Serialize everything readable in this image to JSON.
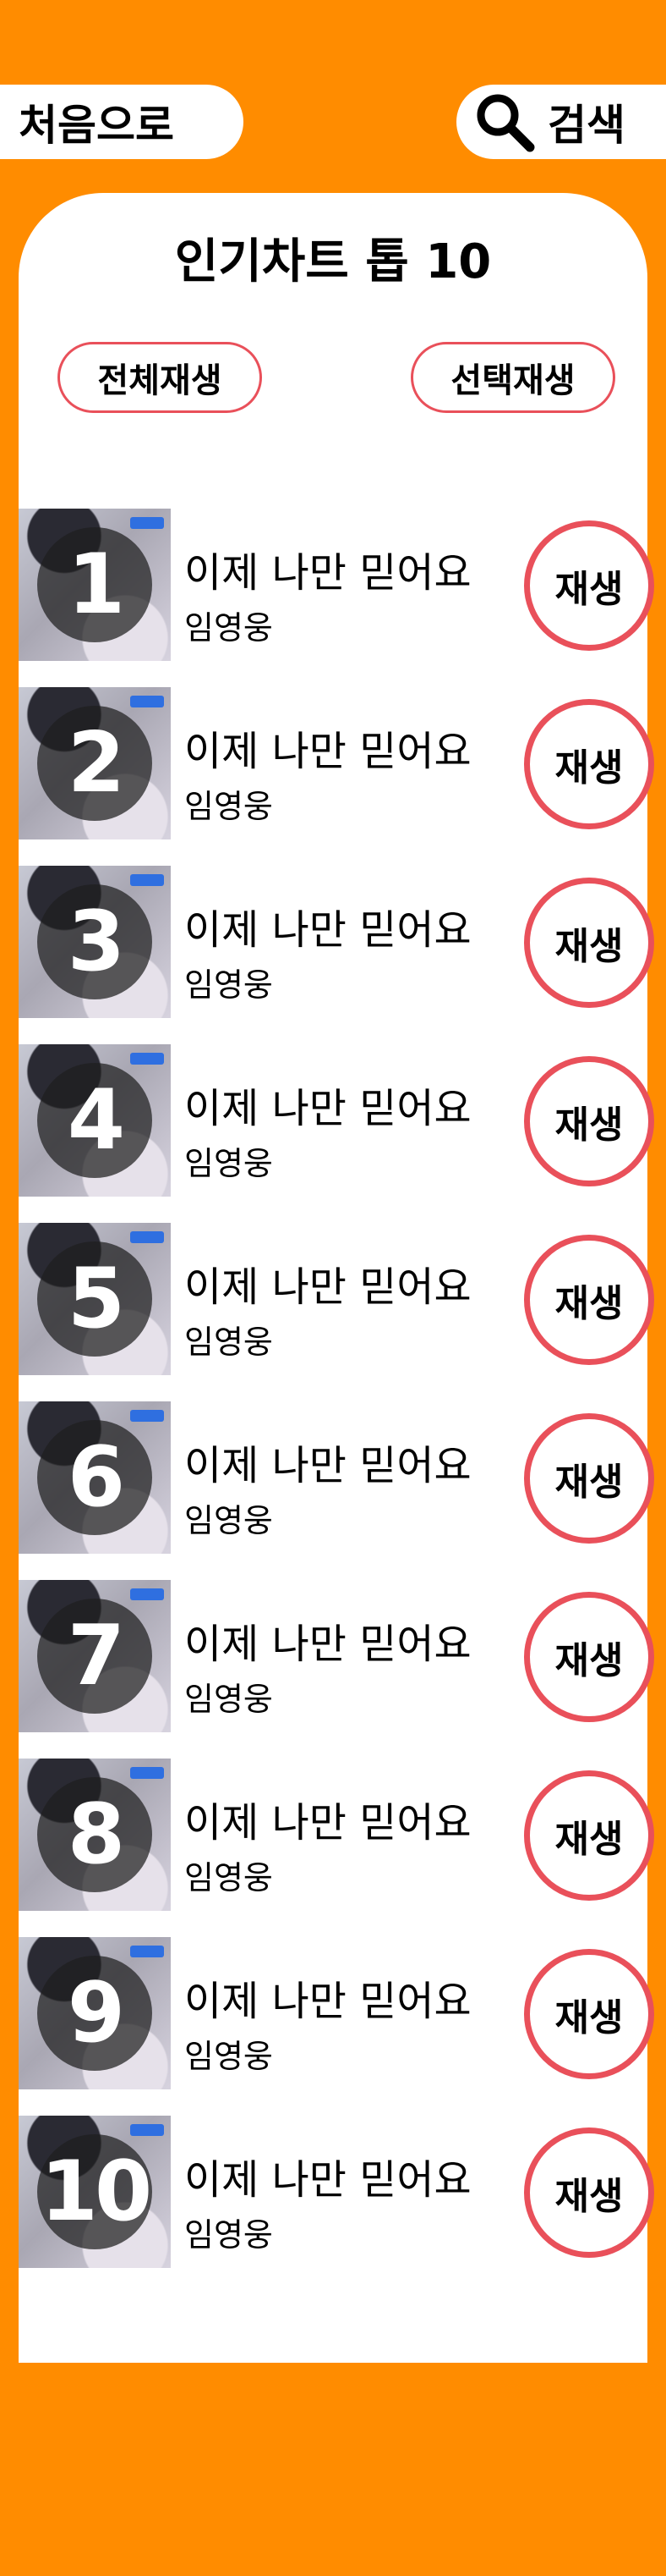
{
  "header": {
    "home_label": "처음으로",
    "search_label": "검색",
    "search_icon": "search-icon"
  },
  "chart": {
    "title": "인기차트 톱 10",
    "play_all_label": "전체재생",
    "play_selected_label": "선택재생",
    "play_label": "재생",
    "items": [
      {
        "rank": "1",
        "title": "이제 나만 믿어요",
        "artist": "임영웅"
      },
      {
        "rank": "2",
        "title": "이제 나만 믿어요",
        "artist": "임영웅"
      },
      {
        "rank": "3",
        "title": "이제 나만 믿어요",
        "artist": "임영웅"
      },
      {
        "rank": "4",
        "title": "이제 나만 믿어요",
        "artist": "임영웅"
      },
      {
        "rank": "5",
        "title": "이제 나만 믿어요",
        "artist": "임영웅"
      },
      {
        "rank": "6",
        "title": "이제 나만 믿어요",
        "artist": "임영웅"
      },
      {
        "rank": "7",
        "title": "이제 나만 믿어요",
        "artist": "임영웅"
      },
      {
        "rank": "8",
        "title": "이제 나만 믿어요",
        "artist": "임영웅"
      },
      {
        "rank": "9",
        "title": "이제 나만 믿어요",
        "artist": "임영웅"
      },
      {
        "rank": "10",
        "title": "이제 나만 믿어요",
        "artist": "임영웅"
      }
    ]
  },
  "colors": {
    "background": "#FF8C00",
    "accent_border": "#E9505A",
    "card": "#FFFFFF"
  }
}
